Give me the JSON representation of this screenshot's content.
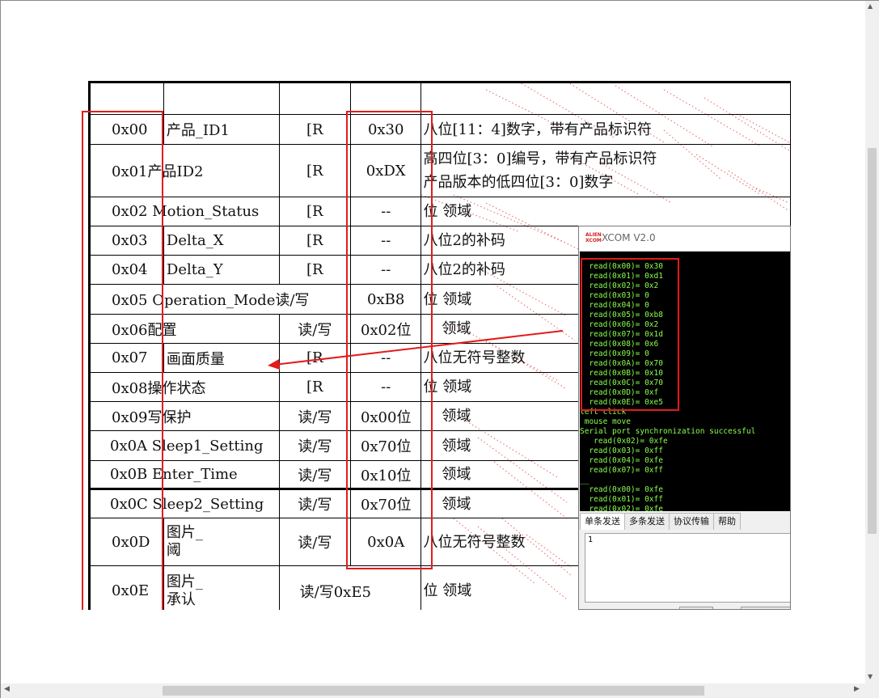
{
  "table": {
    "rows": [
      {
        "addr": "0x00",
        "name": "产品_ID1",
        "access": "[R",
        "default": "0x30",
        "desc": [
          "八位[11：4]数字，带有产品标识符"
        ]
      },
      {
        "addr": "0x01产品ID2",
        "name": "",
        "access": "[R",
        "default": "0xDX",
        "desc": [
          "高四位[3：0]编号，带有产品标识符",
          "产品版本的低四位[3：0]数字"
        ]
      },
      {
        "addr": "0x02 Motion_Status",
        "name": "",
        "access": "[R",
        "default": "--",
        "desc": [
          "位  领域"
        ]
      },
      {
        "addr": "0x03",
        "name": "Delta_X",
        "access": "[R",
        "default": "--",
        "desc": [
          "八位2的补码"
        ]
      },
      {
        "addr": "0x04",
        "name": "Delta_Y",
        "access": "[R",
        "default": "--",
        "desc": [
          "八位2的补码"
        ]
      },
      {
        "addr": "0x05 Operation_Mode读/写",
        "name": "",
        "access": "",
        "default": "0xB8",
        "desc": [
          "位  领域"
        ]
      },
      {
        "addr": "0x06配置",
        "name": "",
        "access": "读/写",
        "default": "0x02位",
        "desc": [
          "    领域"
        ]
      },
      {
        "addr": "0x07",
        "name": "画面质量",
        "access": "[R",
        "default": "--",
        "desc": [
          "八位无符号整数"
        ]
      },
      {
        "addr": "0x08操作状态",
        "name": "",
        "access": "[R",
        "default": "--",
        "desc": [
          "位  领域"
        ]
      },
      {
        "addr": "0x09写保护",
        "name": "",
        "access": "读/写",
        "default": "0x00位",
        "desc": [
          "    领域"
        ]
      },
      {
        "addr": "0x0A Sleep1_Setting",
        "name": "",
        "access": "读/写",
        "default": "0x70位",
        "desc": [
          "    领域"
        ]
      },
      {
        "addr": "0x0B Enter_Time",
        "name": "",
        "access": "读/写",
        "default": "0x10位",
        "desc": [
          "    领域"
        ]
      },
      {
        "addr": "0x0C Sleep2_Setting",
        "name": "",
        "access": "读/写",
        "default": "0x70位",
        "desc": [
          "    领域"
        ]
      },
      {
        "addr": "0x0D",
        "name_lines": [
          "图片_",
          "阈"
        ],
        "access": "读/写",
        "default": "0x0A",
        "desc": [
          "八位无符号整数"
        ]
      },
      {
        "addr": "0x0E",
        "name_lines": [
          "图片_",
          "承认"
        ],
        "access": "读/写0xE5",
        "default": "",
        "desc": [
          "位  领域"
        ]
      }
    ]
  },
  "xcom": {
    "title": "XCOM V2.0",
    "logo": "ALIENTEK XCOM",
    "terminal_lines": [
      "  read(0x00)= 0x30",
      "  read(0x01)= 0xd1",
      "  read(0x02)= 0x2",
      "  read(0x03)= 0",
      "  read(0x04)= 0",
      "  read(0x05)= 0xb8",
      "  read(0x06)= 0x2",
      "  read(0x07)= 0x1d",
      "  read(0x08)= 0x6",
      "  read(0x09)= 0",
      "  read(0x0A)= 0x70",
      "  read(0x0B)= 0x10",
      "  read(0x0C)= 0x70",
      "  read(0x0D)= 0xf",
      "  read(0x0E)= 0xe5",
      "left click",
      " mouse move",
      "Serial port synchronization successful",
      "   read(0x02)= 0xfe",
      "  read(0x03)= 0xff",
      "  read(0x04)= 0xfe",
      "  read(0x07)= 0xff",
      "__",
      "  read(0x00)= 0xfe",
      "  read(0x01)= 0xff",
      "  read(0x02)= 0xfe"
    ],
    "tabs": [
      "单条发送",
      "多条发送",
      "协议传输",
      "帮助"
    ],
    "send_text": "1"
  },
  "colors": {
    "annotation_red": "#e31b1b",
    "terminal_text": "#8cff4f",
    "terminal_bg": "#000000"
  },
  "icons": {
    "arrow": "red-arrow-left",
    "scroll_up": "chevron-up-icon",
    "scroll_down": "chevron-down-icon",
    "scroll_left": "chevron-left-icon",
    "scroll_right": "chevron-right-icon"
  }
}
